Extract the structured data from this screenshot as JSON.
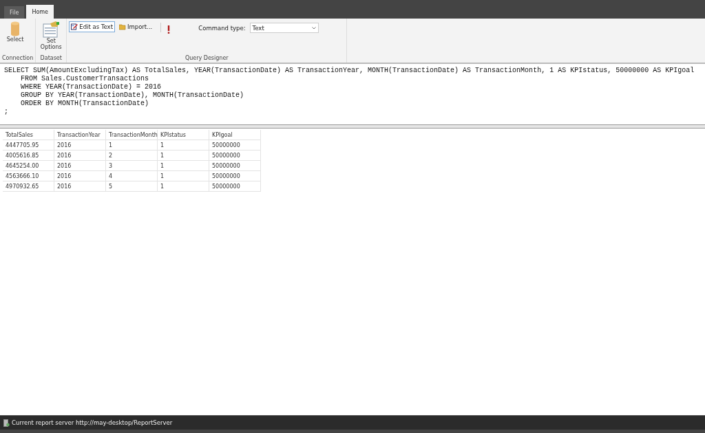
{
  "tabs": [
    {
      "label": "File",
      "selected": false
    },
    {
      "label": "Home",
      "selected": true
    }
  ],
  "ribbon": {
    "groups": [
      {
        "label": "Connection",
        "buttons": [
          {
            "kind": "large",
            "label": "Select"
          }
        ]
      },
      {
        "label": "Dataset",
        "buttons": [
          {
            "kind": "large",
            "label": "Set Options"
          }
        ]
      },
      {
        "label": "Query Designer",
        "buttons": [
          {
            "kind": "small",
            "label": "Edit as Text",
            "selected": true
          },
          {
            "kind": "small",
            "label": "Import...",
            "selected": false
          },
          {
            "kind": "separator"
          },
          {
            "kind": "run"
          },
          {
            "kind": "combo",
            "label": "Command type:",
            "value": "Text"
          }
        ]
      }
    ]
  },
  "query": [
    "SELECT SUM(AmountExcludingTax) AS TotalSales, YEAR(TransactionDate) AS TransactionYear, MONTH(TransactionDate) AS TransactionMonth, 1 AS KPIstatus, 50000000 AS KPIgoal",
    "    FROM Sales.CustomerTransactions",
    "    WHERE YEAR(TransactionDate) = 2016",
    "    GROUP BY YEAR(TransactionDate), MONTH(TransactionDate)",
    "    ORDER BY MONTH(TransactionDate)",
    ";"
  ],
  "table": {
    "columns": [
      "TotalSales",
      "TransactionYear",
      "TransactionMonth",
      "KPIstatus",
      "KPIgoal"
    ],
    "rows": [
      [
        "4447705.95",
        "2016",
        "1",
        "1",
        "50000000"
      ],
      [
        "4005616.85",
        "2016",
        "2",
        "1",
        "50000000"
      ],
      [
        "4645254.00",
        "2016",
        "3",
        "1",
        "50000000"
      ],
      [
        "4563666.10",
        "2016",
        "4",
        "1",
        "50000000"
      ],
      [
        "4970932.65",
        "2016",
        "5",
        "1",
        "50000000"
      ]
    ]
  },
  "status_bar": {
    "text": "Current report server http://may-desktop/ReportServer"
  }
}
